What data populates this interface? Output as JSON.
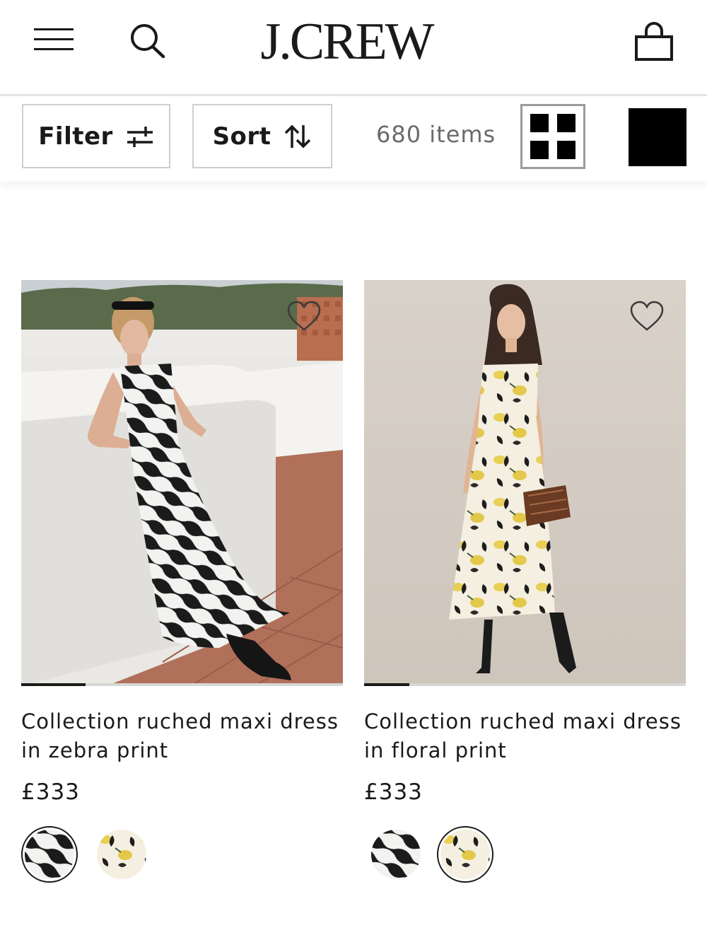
{
  "header": {
    "logo": "J.CREW",
    "menu_icon": "hamburger-menu-icon",
    "search_icon": "search-icon",
    "bag_icon": "shopping-bag-icon"
  },
  "toolbar": {
    "filter_label": "Filter",
    "sort_label": "Sort",
    "item_count": "680 items",
    "view_grid_icon": "grid-view-icon",
    "view_single_icon": "single-view-icon"
  },
  "products": [
    {
      "title": "Collection ruched maxi dress in zebra print",
      "price": "£333",
      "image": "zebra-print-maxi-dress-photo",
      "carousel_progress": 0.2,
      "swatches": [
        {
          "name": "zebra-print",
          "selected": true
        },
        {
          "name": "floral-print",
          "selected": false
        }
      ]
    },
    {
      "title": "Collection ruched maxi dress in floral print",
      "price": "£333",
      "image": "floral-print-maxi-dress-photo",
      "carousel_progress": 0.14,
      "swatches": [
        {
          "name": "zebra-print",
          "selected": false
        },
        {
          "name": "floral-print",
          "selected": true
        }
      ]
    }
  ],
  "colors": {
    "text": "#1a1a1a",
    "muted": "#6b6b6b",
    "border": "#cfcfcf"
  }
}
